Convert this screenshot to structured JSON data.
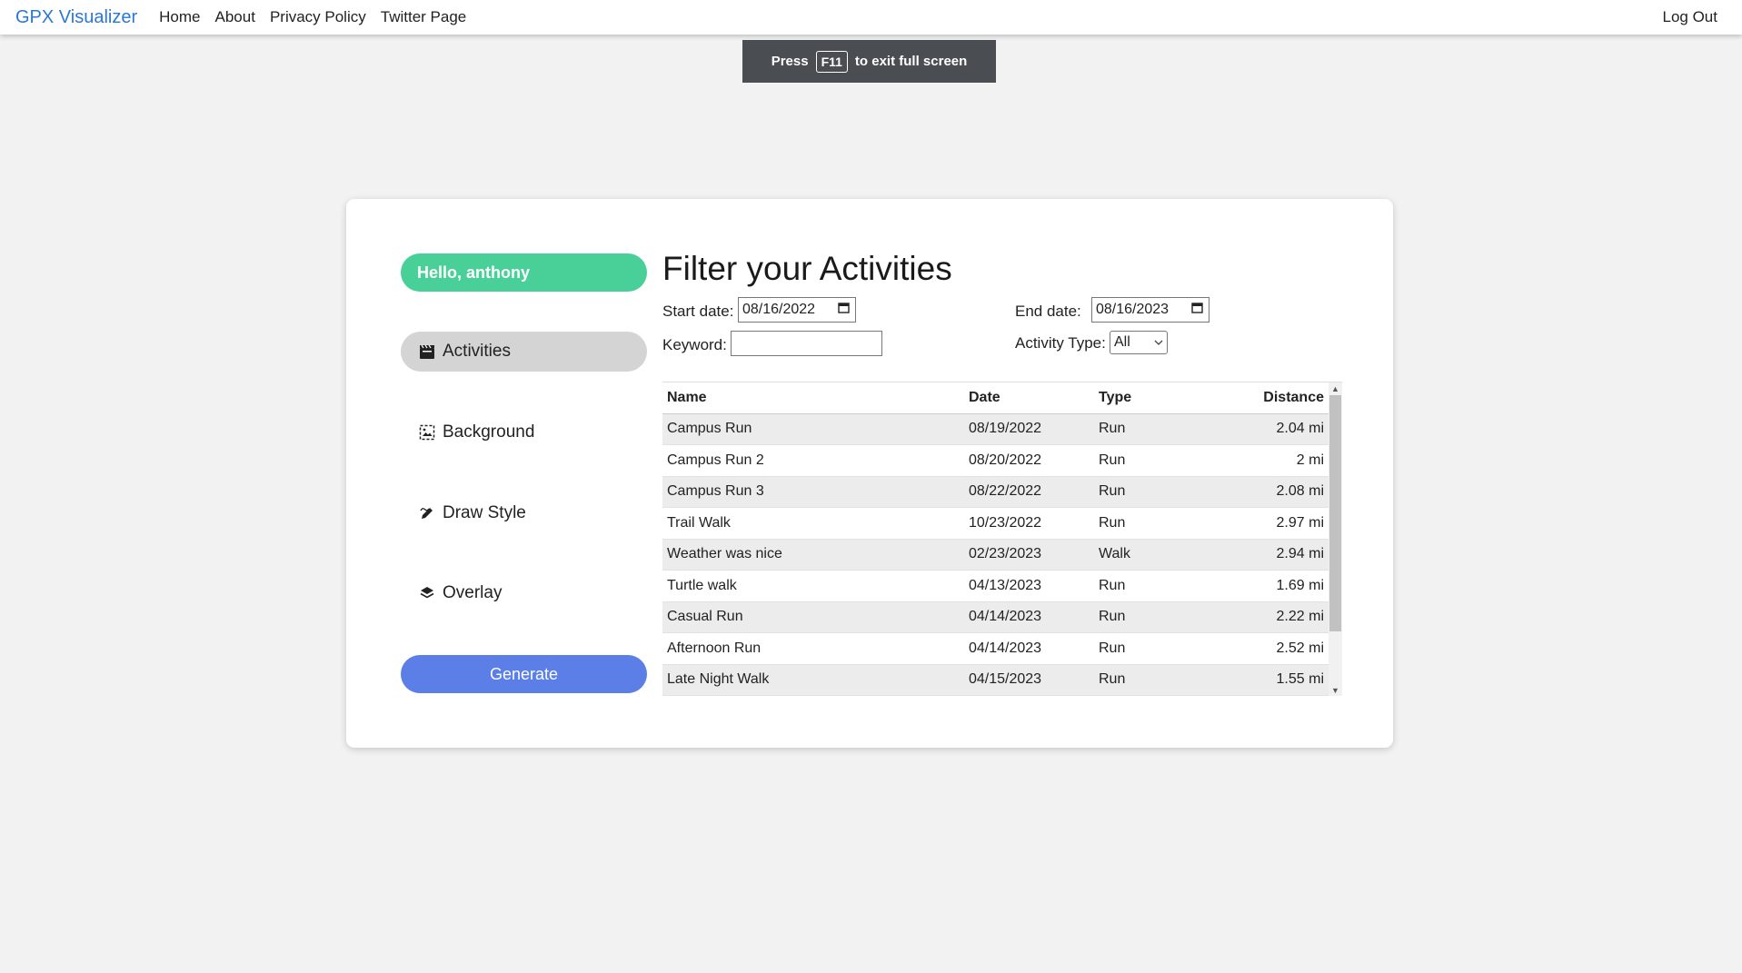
{
  "nav": {
    "brand": "GPX Visualizer",
    "links": [
      "Home",
      "About",
      "Privacy Policy",
      "Twitter Page"
    ],
    "logout": "Log Out"
  },
  "toast": {
    "press": "Press",
    "key": "F11",
    "message": "to exit full screen"
  },
  "sidebar": {
    "greeting": "Hello, anthony",
    "items": [
      {
        "label": "Activities",
        "icon": "activities-icon",
        "active": true
      },
      {
        "label": "Background",
        "icon": "image-icon",
        "active": false
      },
      {
        "label": "Draw Style",
        "icon": "draw-icon",
        "active": false
      },
      {
        "label": "Overlay",
        "icon": "layers-icon",
        "active": false
      }
    ],
    "generate": "Generate"
  },
  "filter": {
    "title": "Filter your Activities",
    "start_label": "Start date:",
    "start_value": "08/16/2022",
    "end_label": "End date:",
    "end_value": "08/16/2023",
    "keyword_label": "Keyword:",
    "keyword_value": "",
    "type_label": "Activity Type:",
    "type_value": "All"
  },
  "table": {
    "headers": [
      "Name",
      "Date",
      "Type",
      "Distance"
    ],
    "rows": [
      [
        "Campus Run",
        "08/19/2022",
        "Run",
        "2.04 mi"
      ],
      [
        "Campus Run 2",
        "08/20/2022",
        "Run",
        "2 mi"
      ],
      [
        "Campus Run 3",
        "08/22/2022",
        "Run",
        "2.08 mi"
      ],
      [
        "Trail Walk",
        "10/23/2022",
        "Run",
        "2.97 mi"
      ],
      [
        "Weather was nice",
        "02/23/2023",
        "Walk",
        "2.94 mi"
      ],
      [
        "Turtle walk",
        "04/13/2023",
        "Run",
        "1.69 mi"
      ],
      [
        "Casual Run",
        "04/14/2023",
        "Run",
        "2.22 mi"
      ],
      [
        "Afternoon Run",
        "04/14/2023",
        "Run",
        "2.52 mi"
      ],
      [
        "Late Night Walk",
        "04/15/2023",
        "Run",
        "1.55 mi"
      ]
    ]
  },
  "colors": {
    "brand": "#2a78d6",
    "greeting_bg": "#49cf98",
    "generate_bg": "#5b7fe6",
    "active_item_bg": "#d4d4d4"
  }
}
